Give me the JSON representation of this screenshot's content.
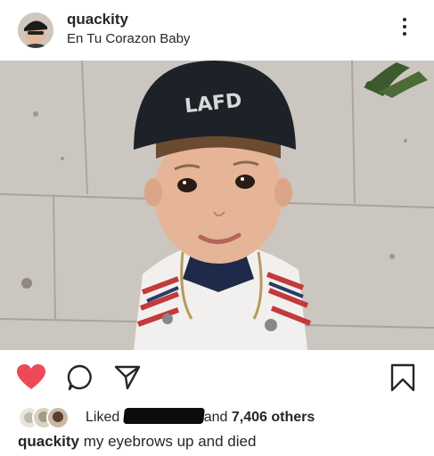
{
  "post": {
    "username": "quackity",
    "location": "En Tu Corazon Baby",
    "photo_cap_text": "LAFD"
  },
  "actions": {
    "like_icon": "heart-filled-icon",
    "comment_icon": "comment-bubble-icon",
    "share_icon": "paper-plane-icon",
    "save_icon": "bookmark-icon",
    "like_color": "#ed4956"
  },
  "likes": {
    "liked_label": "Liked",
    "and_label": "and",
    "count_label": "7,406 others"
  },
  "caption": {
    "username": "quackity",
    "text": "my eyebrows up and died"
  }
}
